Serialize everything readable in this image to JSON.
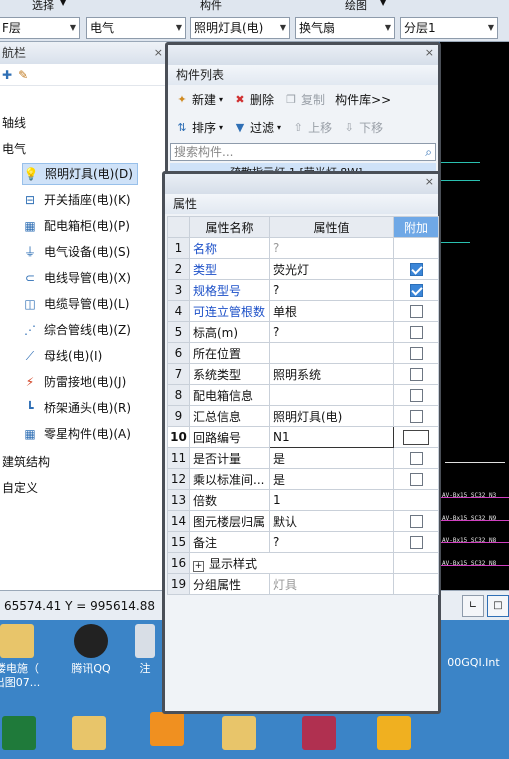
{
  "topbar": {
    "tab_labels": [
      "选择",
      "构件",
      "绘图"
    ],
    "combos": [
      "F层",
      "电气",
      "照明灯具(电)",
      "换气扇",
      "分层1"
    ]
  },
  "nav": {
    "title": "航栏",
    "categories": [
      "轴线",
      "电气",
      "建筑结构",
      "自定义"
    ],
    "items": [
      {
        "label": "照明灯具(电)(D)",
        "icon": "bulb-icon"
      },
      {
        "label": "开关插座(电)(K)",
        "icon": "switch-icon"
      },
      {
        "label": "配电箱柜(电)(P)",
        "icon": "panel-icon"
      },
      {
        "label": "电气设备(电)(S)",
        "icon": "plug-icon"
      },
      {
        "label": "电线导管(电)(X)",
        "icon": "conduit-icon"
      },
      {
        "label": "电缆导管(电)(L)",
        "icon": "cable-icon"
      },
      {
        "label": "综合管线(电)(Z)",
        "icon": "pipeline-icon"
      },
      {
        "label": "母线(电)(I)",
        "icon": "busbar-icon"
      },
      {
        "label": "防雷接地(电)(J)",
        "icon": "lightning-icon"
      },
      {
        "label": "桥架通头(电)(R)",
        "icon": "tray-icon"
      },
      {
        "label": "零星构件(电)(A)",
        "icon": "grid-icon"
      }
    ]
  },
  "status": {
    "coord": "65574.41 Y = 995614.88"
  },
  "list_window": {
    "title": "构件列表",
    "buttons": {
      "new": "新建",
      "delete": "删除",
      "copy": "复制",
      "library": "构件库>>",
      "sort": "排序",
      "filter": "过滤",
      "up": "上移",
      "down": "下移"
    },
    "search_placeholder": "搜索构件...",
    "partial_row": "疏散指示灯-1 [荧光灯 8W]"
  },
  "prop_window": {
    "title": "属性",
    "headers": [
      "属性名称",
      "属性值",
      "附加"
    ],
    "rows": [
      {
        "num": "1",
        "name": "名称",
        "value": "?"
      },
      {
        "num": "2",
        "name": "类型",
        "value": "荧光灯"
      },
      {
        "num": "3",
        "name": "规格型号",
        "value": "?"
      },
      {
        "num": "4",
        "name": "可连立管根数",
        "value": "单根"
      },
      {
        "num": "5",
        "name": "标高(m)",
        "value": "?"
      },
      {
        "num": "6",
        "name": "所在位置",
        "value": ""
      },
      {
        "num": "7",
        "name": "系统类型",
        "value": "照明系统"
      },
      {
        "num": "8",
        "name": "配电箱信息",
        "value": ""
      },
      {
        "num": "9",
        "name": "汇总信息",
        "value": "照明灯具(电)"
      },
      {
        "num": "10",
        "name": "回路编号",
        "value": "N1"
      },
      {
        "num": "11",
        "name": "是否计量",
        "value": "是"
      },
      {
        "num": "12",
        "name": "乘以标准间...",
        "value": "是"
      },
      {
        "num": "13",
        "name": "倍数",
        "value": "1"
      },
      {
        "num": "14",
        "name": "图元楼层归属",
        "value": "默认"
      },
      {
        "num": "15",
        "name": "备注",
        "value": "?"
      },
      {
        "num": "16",
        "name": "显示样式",
        "value": ""
      },
      {
        "num": "19",
        "name": "分组属性",
        "value": "灯具"
      }
    ]
  },
  "desktop": {
    "icons": [
      "楼电施（\n出图07...",
      "腾讯QQ",
      "注",
      "00GQI.Int"
    ]
  },
  "cad_labels": [
    "AV-Bx15",
    "SC32",
    "N3",
    "AV-Bx15",
    "SC32",
    "N9",
    "AV-Bx15",
    "SC32",
    "N8",
    "AV-Bx15",
    "SC32",
    "N8"
  ]
}
